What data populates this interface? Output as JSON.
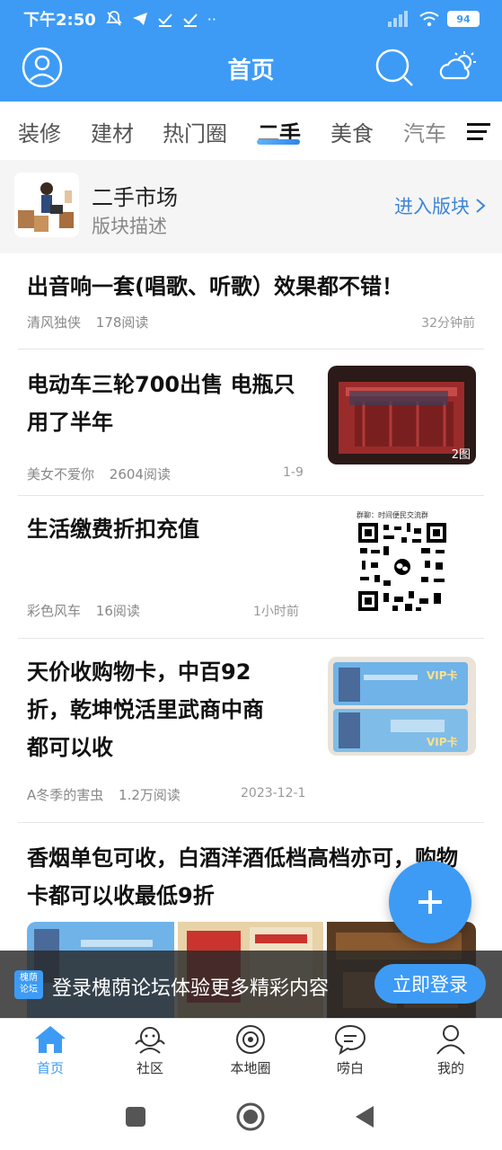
{
  "status_bar": {
    "time": "下午2:50",
    "battery": "94"
  },
  "header": {
    "title": "首页"
  },
  "tabs": [
    {
      "label": "装修"
    },
    {
      "label": "建材"
    },
    {
      "label": "热门圈"
    },
    {
      "label": "二手",
      "active": true
    },
    {
      "label": "美食"
    },
    {
      "label": "汽车"
    }
  ],
  "section": {
    "name": "二手市场",
    "description": "版块描述",
    "enter_label": "进入版块"
  },
  "posts": [
    {
      "title": "出音响一套(唱歌、听歌）效果都不错！",
      "author": "清风独侠",
      "reads": "178阅读",
      "time": "32分钟前"
    },
    {
      "title_lines": [
        "电动车三轮700出售 电瓶只",
        "用了半年"
      ],
      "author": "美女不爱你",
      "reads": "2604阅读",
      "time": "1-9",
      "image_count": "2图"
    },
    {
      "title": "生活缴费折扣充值",
      "author": "彩色风车",
      "reads": "16阅读",
      "time": "1小时前",
      "image_text": "群聊：时间便民交流群"
    },
    {
      "title_lines": [
        "天价收购物卡，中百92",
        "折，乾坤悦活里武商中商",
        "都可以收"
      ],
      "author": "A冬季的害虫",
      "reads": "1.2万阅读",
      "time": "2023-12-1",
      "image_text": "VIP卡"
    },
    {
      "title_lines": [
        "香烟单包可收，白酒洋酒低档高档亦可，购物",
        "卡都可以收最低9折"
      ]
    }
  ],
  "login_bar": {
    "logo_text": "槐荫论坛",
    "message": "登录槐荫论坛体验更多精彩内容",
    "button_label": "立即登录"
  },
  "bottom_nav": [
    {
      "label": "首页",
      "active": true
    },
    {
      "label": "社区"
    },
    {
      "label": "本地圈"
    },
    {
      "label": "唠白"
    },
    {
      "label": "我的"
    }
  ],
  "colors": {
    "primary": "#3d9bf5",
    "link": "#3d86d8"
  }
}
